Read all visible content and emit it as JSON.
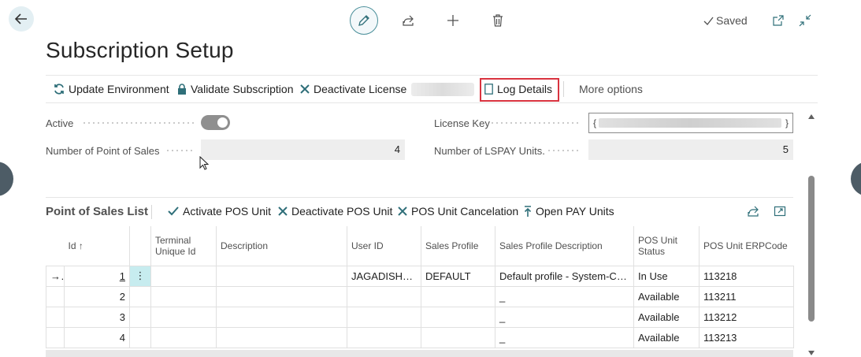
{
  "page": {
    "title": "Subscription Setup",
    "saved_label": "Saved"
  },
  "actions": {
    "update_environment": "Update Environment",
    "validate_subscription": "Validate Subscription",
    "deactivate_license": "Deactivate License",
    "log_details": "Log Details",
    "more_options": "More options"
  },
  "fields": {
    "active_label": "Active",
    "active_value": true,
    "num_pos_label": "Number of Point of Sales",
    "num_pos_value": "4",
    "license_key_label": "License Key",
    "license_key_open": "{",
    "license_key_close": "}",
    "num_lspay_label": "Number of LSPAY Units.",
    "num_lspay_value": "5"
  },
  "pos_list": {
    "title": "Point of Sales List",
    "actions": {
      "activate": "Activate POS Unit",
      "deactivate": "Deactivate POS Unit",
      "cancel": "POS Unit Cancelation",
      "open_pay": "Open PAY Units"
    },
    "columns": {
      "id": "Id",
      "terminal_line1": "Terminal",
      "terminal_line2": "Unique Id",
      "description": "Description",
      "user_id": "User ID",
      "sales_profile": "Sales Profile",
      "sales_profile_desc": "Sales Profile Description",
      "status_line1": "POS Unit",
      "status_line2": "Status",
      "erp_code": "POS Unit ERPCode"
    },
    "rows": [
      {
        "id": "1",
        "terminal": "",
        "description": "",
        "user_id": "JAGADISHRA",
        "sales_profile": "DEFAULT",
        "sales_profile_desc": "Default profile - System-Cre...",
        "status": "In Use",
        "erp_code": "113218"
      },
      {
        "id": "2",
        "terminal": "",
        "description": "",
        "user_id": "",
        "sales_profile": "",
        "sales_profile_desc": "_",
        "status": "Available",
        "erp_code": "113211"
      },
      {
        "id": "3",
        "terminal": "",
        "description": "",
        "user_id": "",
        "sales_profile": "",
        "sales_profile_desc": "_",
        "status": "Available",
        "erp_code": "113212"
      },
      {
        "id": "4",
        "terminal": "",
        "description": "",
        "user_id": "",
        "sales_profile": "",
        "sales_profile_desc": "_",
        "status": "Available",
        "erp_code": "113213"
      }
    ]
  },
  "colors": {
    "accent": "#00706e",
    "highlight_border": "#d9333f",
    "selected_cell": "#c7ecef"
  }
}
